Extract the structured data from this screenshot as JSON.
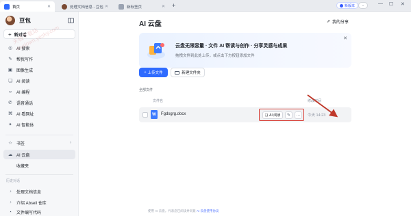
{
  "tabs": [
    {
      "label": "首页",
      "active": true,
      "favicon_color": "#2f6bff"
    },
    {
      "label": "处理文档信息 - 豆包",
      "active": false,
      "favicon_color": "#7a4a33"
    },
    {
      "label": "新标签页",
      "active": false,
      "favicon_color": "#9aa3b2"
    }
  ],
  "topbar": {
    "new_version": "新版本",
    "new_tab_icon": "plus-icon",
    "profile_dropdown_icon": "chevron-down-icon"
  },
  "sidebar": {
    "brand": "豆包",
    "new_chat": "新对话",
    "items": [
      {
        "label": "AI 搜索",
        "icon": "search-icon",
        "glyph": "◎"
      },
      {
        "label": "帮我写作",
        "icon": "pen-icon",
        "glyph": "✎"
      },
      {
        "label": "图像生成",
        "icon": "image-icon",
        "glyph": "▣"
      },
      {
        "label": "AI 阅读",
        "icon": "book-icon",
        "glyph": "❏"
      },
      {
        "label": "AI 编程",
        "icon": "code-icon",
        "glyph": "‹›"
      },
      {
        "label": "语音通话",
        "icon": "phone-icon",
        "glyph": "✆"
      },
      {
        "label": "AI 看网址",
        "icon": "link-icon",
        "glyph": "⌘"
      },
      {
        "label": "AI 智能体",
        "icon": "agent-icon",
        "glyph": "✦"
      }
    ],
    "library": [
      {
        "label": "书签",
        "icon": "bookmark-icon",
        "glyph": "☆"
      },
      {
        "label": "AI 云盘",
        "icon": "cloud-icon",
        "glyph": "☁",
        "active": true
      },
      {
        "label": "收藏夹",
        "icon": "star-icon",
        "glyph": ""
      }
    ],
    "history_label": "历史对话",
    "history": [
      {
        "label": "处理文档信息",
        "icon": "chat-icon",
        "glyph": "◔"
      },
      {
        "label": "介绍 Abseil 仓库",
        "icon": "chat-icon",
        "glyph": "◔"
      },
      {
        "label": "文件编写代码",
        "icon": "chat-icon",
        "glyph": "◔"
      }
    ]
  },
  "main": {
    "title": "AI 云盘",
    "my_share": "我的分享",
    "banner": {
      "title": "云盘无限容量 · 文件 AI 帮读与创作 · 分享灵感与成果",
      "subtitle": "拖拽文件到此处上传，或点击下方按钮添加文件"
    },
    "upload_label": "上传文件",
    "new_folder_label": "新建文件夹",
    "all_files_label": "全部文件",
    "table": {
      "col_name": "文件名",
      "col_modified": "修改时间",
      "rows": [
        {
          "name": "Fgdsgrg.docx",
          "modified": "今天 14:23",
          "ai_read": "AI 阅读"
        }
      ]
    },
    "footer": {
      "text": "使用 AI 云盘，代表您已阅读并同意",
      "link": "AI 云盘使用协议"
    }
  },
  "watermark": "天极下载站\nmydown.yesky.com",
  "colors": {
    "accent": "#2f6bff",
    "highlight_box": "#d6382f",
    "arrow": "#c0392b"
  }
}
